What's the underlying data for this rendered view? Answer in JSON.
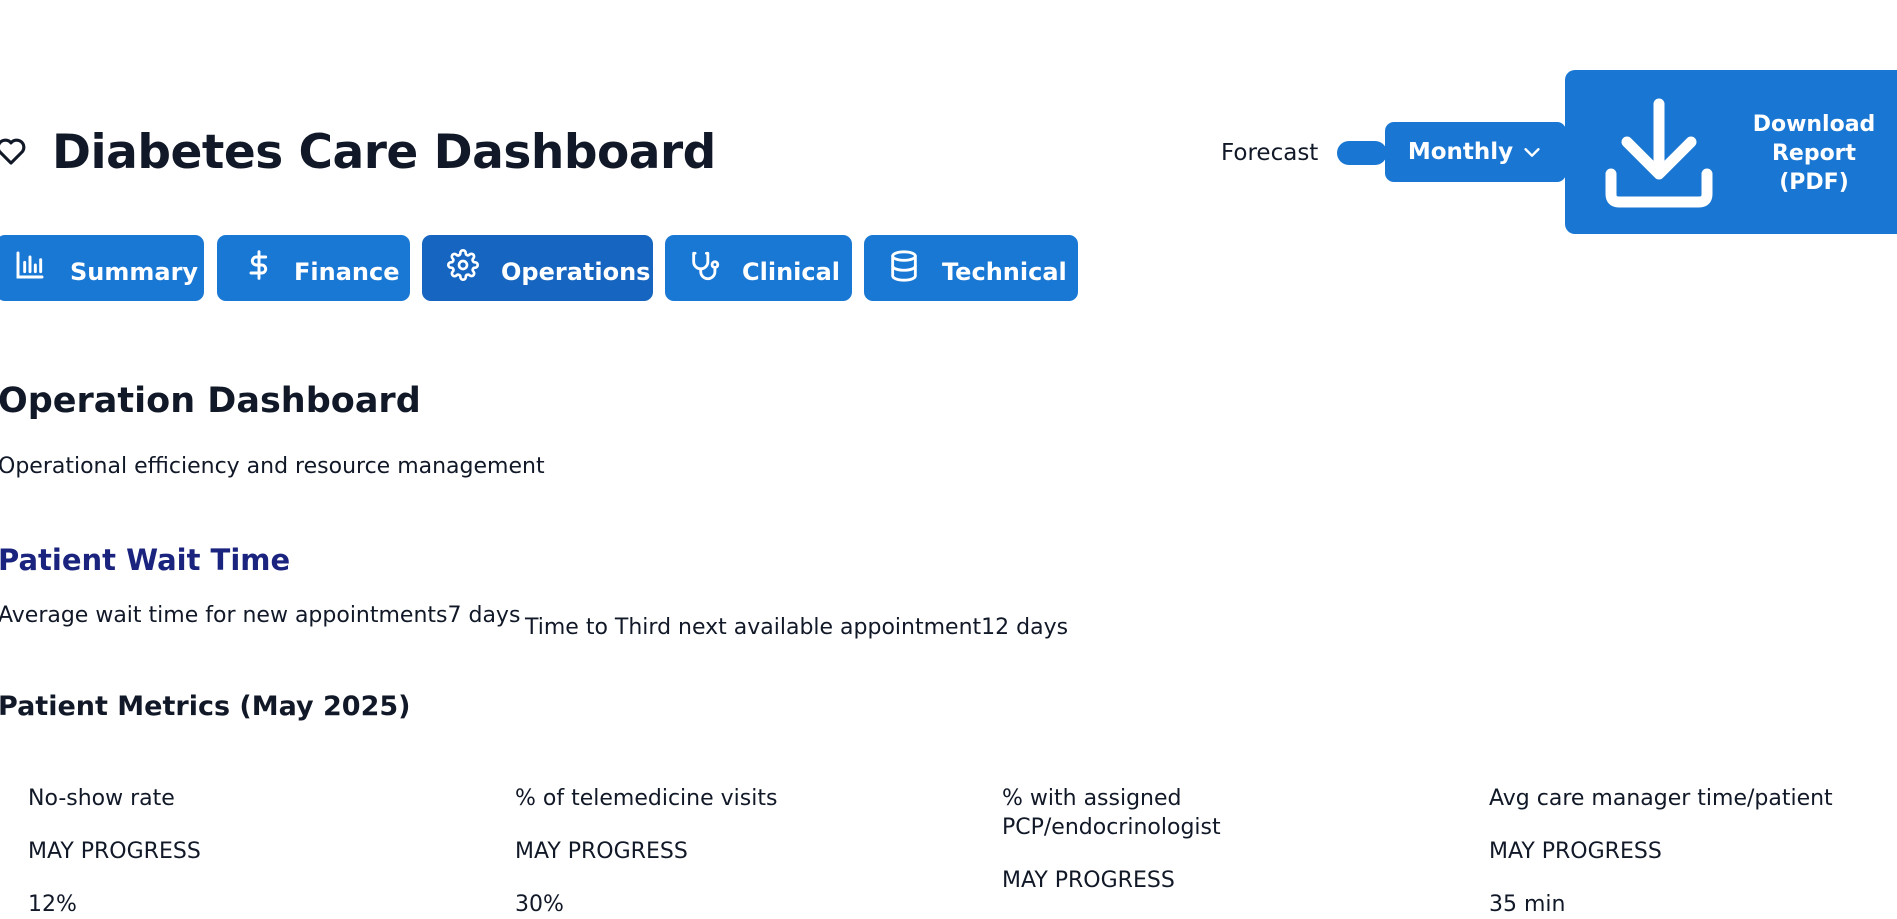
{
  "header": {
    "title": "Diabetes Care Dashboard",
    "forecast_label": "Forecast",
    "period_select": "Monthly",
    "download_label": "Download\nReport\n(PDF)"
  },
  "tabs": [
    {
      "label": "Summary",
      "icon": "bar-chart-icon",
      "active": false
    },
    {
      "label": "Finance",
      "icon": "dollar-icon",
      "active": false
    },
    {
      "label": "Operations",
      "icon": "gear-icon",
      "active": true
    },
    {
      "label": "Clinical",
      "icon": "stethoscope-icon",
      "active": false
    },
    {
      "label": "Technical",
      "icon": "database-icon",
      "active": false
    }
  ],
  "section": {
    "title": "Operation Dashboard",
    "subtitle": "Operational efficiency and resource management"
  },
  "wait_time": {
    "title": "Patient Wait Time",
    "items": [
      {
        "label": "Average wait time for new appointments",
        "value": "7 days"
      },
      {
        "label": "Time to Third next available appointment",
        "value": "12 days"
      }
    ]
  },
  "metrics": {
    "title": "Patient Metrics (May 2025)",
    "cards": [
      {
        "label": "No-show rate",
        "sub": "MAY PROGRESS",
        "value": "12%"
      },
      {
        "label": "% of telemedicine visits",
        "sub": "MAY PROGRESS",
        "value": "30%"
      },
      {
        "label": "% with assigned PCP/endocrinologist",
        "sub": "MAY PROGRESS",
        "value": ""
      },
      {
        "label": "Avg care manager time/patient",
        "sub": "MAY PROGRESS",
        "value": "35 min"
      }
    ]
  },
  "colors": {
    "primary": "#1976d2",
    "active_tab": "#1665c0",
    "heading_accent": "#1a237e",
    "text": "#111827"
  }
}
